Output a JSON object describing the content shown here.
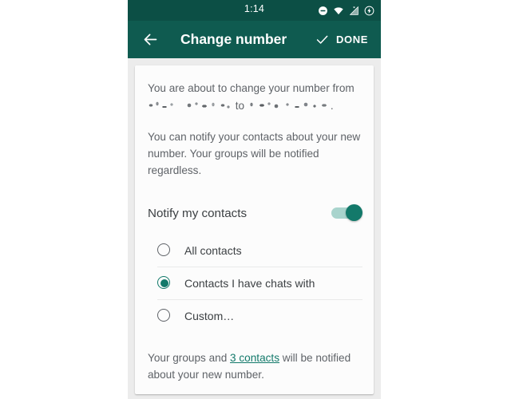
{
  "status_bar": {
    "time": "1:14",
    "icons": [
      "do-not-disturb-icon",
      "wifi-icon",
      "cellular-signal-icon",
      "battery-saver-icon"
    ]
  },
  "toolbar": {
    "back_icon": "arrow-left-icon",
    "title": "Change number",
    "done_icon": "check-icon",
    "done_label": "DONE"
  },
  "card": {
    "intro_line1": "You are about to change your number from",
    "intro_from_redacted": "[redacted phone number]",
    "intro_separator": "to",
    "intro_to_redacted": "[redacted phone number]",
    "intro_period": ".",
    "notify_paragraph": "You can notify your contacts about your new number. Your groups will be notified regardless.",
    "toggle_label": "Notify my contacts",
    "toggle_state": "on",
    "options": [
      {
        "label": "All contacts",
        "selected": false
      },
      {
        "label": "Contacts I have chats with",
        "selected": true
      },
      {
        "label": "Custom…",
        "selected": false
      }
    ],
    "footer_prefix": "Your groups and ",
    "footer_link": "3 contacts",
    "footer_suffix": " will be notified about your new number."
  },
  "colors": {
    "status_bar": "#0c4f45",
    "toolbar": "#0f5b50",
    "accent": "#12796a",
    "toggle_track": "#a9d4cd",
    "page_background": "#ececec",
    "card_background": "#fcfcfc",
    "body_text": "#5f6368"
  }
}
